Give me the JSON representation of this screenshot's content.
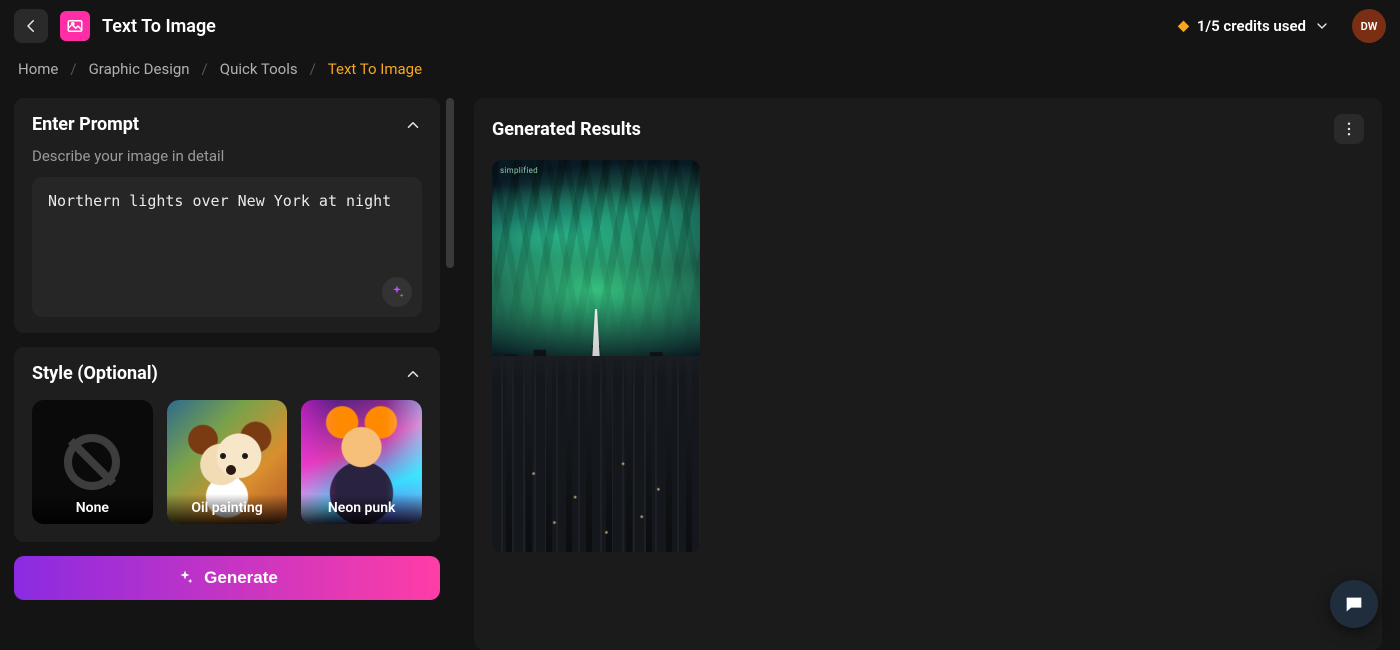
{
  "header": {
    "title": "Text To Image",
    "credits_label": "1/5 credits used",
    "avatar_initials": "DW"
  },
  "breadcrumbs": {
    "items": [
      "Home",
      "Graphic Design",
      "Quick Tools"
    ],
    "current": "Text To Image"
  },
  "prompt": {
    "panel_title": "Enter Prompt",
    "subtext": "Describe your image in detail",
    "value": "Northern lights over New York at night"
  },
  "style": {
    "panel_title": "Style (Optional)",
    "options": [
      {
        "label": "None"
      },
      {
        "label": "Oil painting"
      },
      {
        "label": "Neon punk"
      }
    ]
  },
  "actions": {
    "generate_label": "Generate"
  },
  "results": {
    "title": "Generated Results",
    "watermark": "simplified"
  }
}
